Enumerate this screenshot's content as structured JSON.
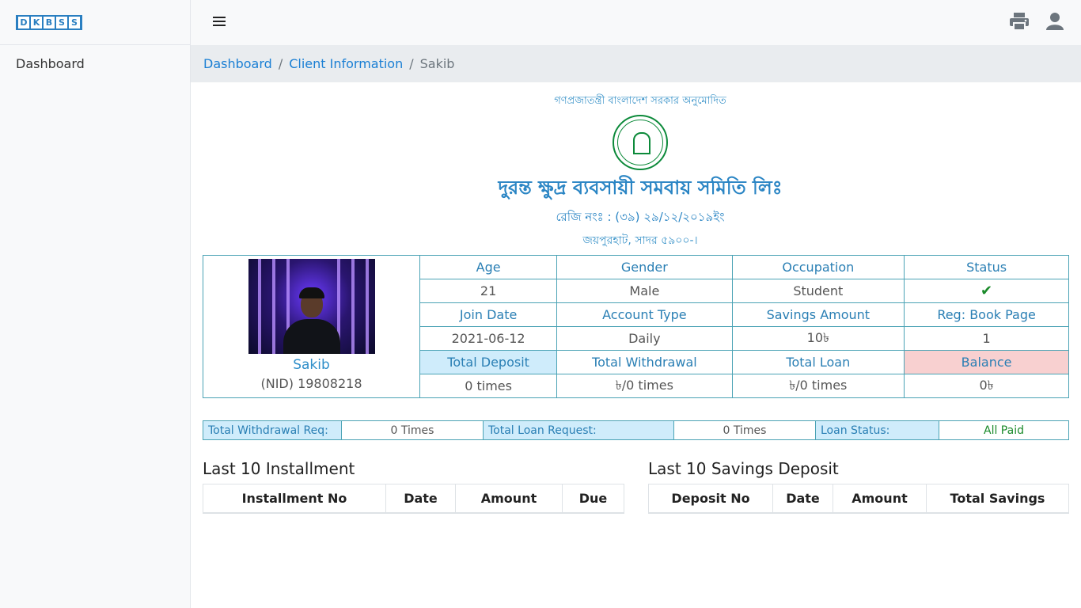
{
  "brand": {
    "letters": [
      "D",
      "K",
      "B",
      "S",
      "S"
    ]
  },
  "sidebar": {
    "items": [
      {
        "label": "Dashboard"
      }
    ]
  },
  "topbar": {
    "menu_icon": "hamburger-icon",
    "print_icon": "print-icon",
    "user_icon": "user-icon"
  },
  "breadcrumb": {
    "items": [
      "Dashboard",
      "Client Information"
    ],
    "current": "Sakib",
    "separator": "/"
  },
  "org": {
    "government": "গণপ্রজাতন্ত্রী বাংলাদেশ সরকার অনুমোদিত",
    "name": "দুরন্ত ক্ষুদ্র ব্যবসায়ী সমবায় সমিতি লিঃ",
    "registration": "রেজি নংঃ : (৩৯) ২৯/১২/২০১৯ইং",
    "address": "জয়পুরহাট, সাদর ৫৯০০-।"
  },
  "client": {
    "name": "Sakib",
    "nid": "(NID) 19808218",
    "headers_row1": [
      "Age",
      "Gender",
      "Occupation",
      "Status"
    ],
    "values_row1": [
      "21",
      "Male",
      "Student"
    ],
    "status_icon": "check-icon",
    "status_symbol": "✔",
    "headers_row2": [
      "Join Date",
      "Account Type",
      "Savings Amount",
      "Reg: Book Page"
    ],
    "values_row2": [
      "2021-06-12",
      "Daily",
      "10৳",
      "1"
    ],
    "headers_row3": [
      "Total Deposit",
      "Total Withdrawal",
      "Total Loan",
      "Balance"
    ],
    "values_row3": [
      "0 times",
      "৳/0 times",
      "৳/0 times",
      "0৳"
    ]
  },
  "summary": {
    "withdrawal_req_label": "Total Withdrawal Req:",
    "withdrawal_req_value": "0 Times",
    "loan_request_label": "Total Loan Request:",
    "loan_request_value": "0 Times",
    "loan_status_label": "Loan Status:",
    "loan_status_value": "All Paid"
  },
  "installments": {
    "title": "Last 10 Installment",
    "columns": [
      "Installment No",
      "Date",
      "Amount",
      "Due"
    ]
  },
  "savings": {
    "title": "Last 10 Savings Deposit",
    "columns": [
      "Deposit No",
      "Date",
      "Amount",
      "Total Savings"
    ]
  },
  "colors": {
    "accent": "#2a7fc1",
    "link": "#1a7fd4",
    "table_border": "#4ba3b5",
    "deposit_bg": "#cfecfb",
    "balance_bg": "#f8d0d0",
    "success": "#1a8a2a"
  }
}
